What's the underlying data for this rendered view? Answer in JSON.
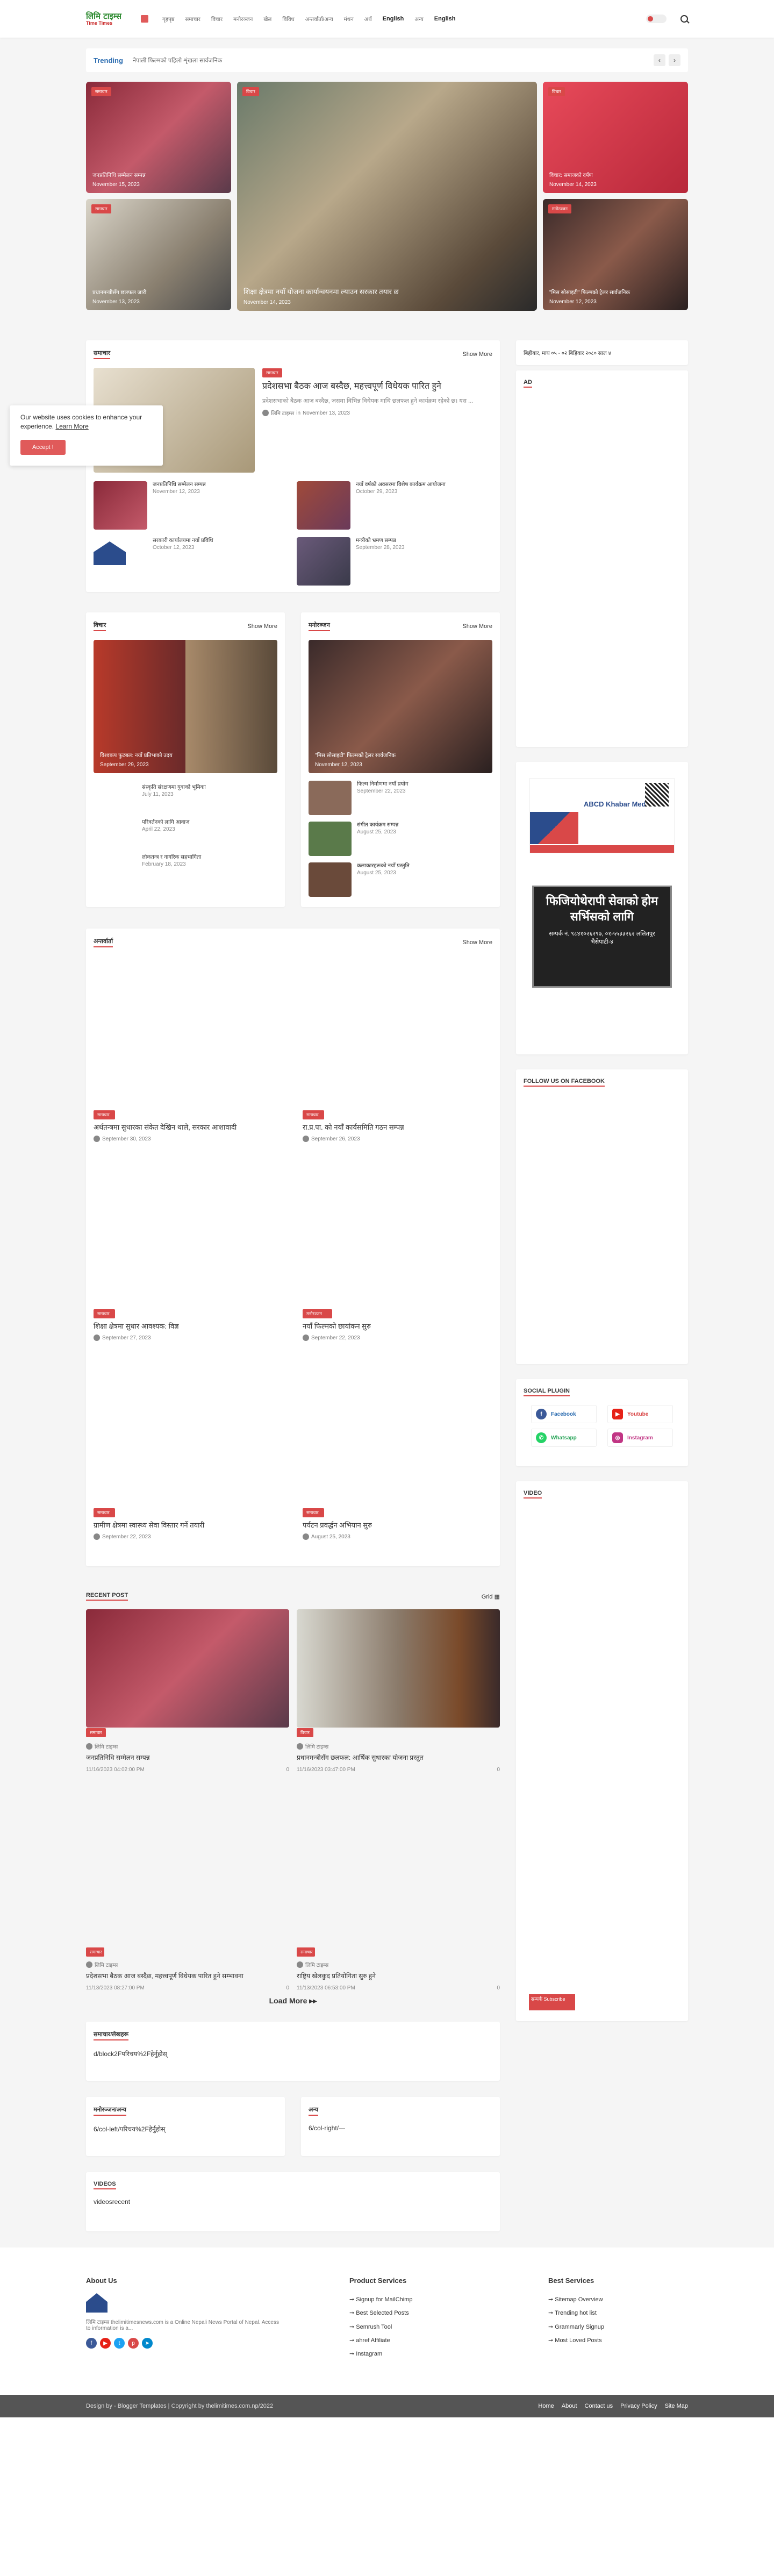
{
  "header": {
    "logo_text": "लिमि टाइम्स",
    "logo_sub": "Time Times",
    "nav": [
      "गृहपृष्ठ",
      "समाचार",
      "विचार",
      "मनोरञ्जन",
      "खेल",
      "विविध",
      "अन्तर्वार्ता/अन्य",
      "मंथन",
      "अर्थ",
      "English",
      "अन्य",
      "English"
    ]
  },
  "trending": {
    "label": "Trending",
    "text": "नेपाली फिल्मको पहिलो शृंखला सार्वजनिक"
  },
  "hero": [
    {
      "label": "समाचार",
      "title": "जनप्रतिनिधि सम्मेलन सम्पन्न",
      "date": "November 15, 2023",
      "comments": "0"
    },
    {
      "label": "समाचार",
      "title": "प्रधानमन्त्रीसँग छलफल जारी",
      "date": "November 13, 2023",
      "comments": "0"
    },
    {
      "label": "विचार",
      "title": "शिक्षा क्षेत्रमा नयाँ योजना कार्यान्वयनमा ल्याउन सरकार तयार छ",
      "date": "November 14, 2023",
      "comments": "0"
    },
    {
      "label": "विचार",
      "title": "विचार: समाजको दर्पण",
      "date": "November 14, 2023",
      "comments": "0"
    },
    {
      "label": "मनोरञ्जन",
      "title": "\"मिस सोसाइटी\" फिल्मको ट्रेलर सार्वजनिक",
      "date": "November 12, 2023",
      "comments": "0"
    }
  ],
  "sec1": {
    "title": "समाचार",
    "show_more": "Show More",
    "lead_title": "प्रदेशसभा बैठक आज बस्दैछ, महत्त्वपूर्ण विधेयक पारित हुने",
    "lead_excerpt": "प्रदेशसभाको बैठक आज बस्दैछ, जसमा विभिन्न विधेयक माथि छलफल हुने कार्यक्रम रहेको छ। यस ...",
    "lead_author": "लिमि टाइम्स",
    "lead_date": "November 13, 2023",
    "items": [
      {
        "title": "जनप्रतिनिधि सम्मेलन सम्पन्न",
        "date": "November 12, 2023"
      },
      {
        "title": "नयाँ वर्षको अवसरमा विशेष कार्यक्रम आयोजना",
        "date": "October 29, 2023"
      },
      {
        "title": "सरकारी कार्यालयमा नयाँ प्रविधि",
        "date": "October 12, 2023"
      },
      {
        "title": "मन्त्रीको भ्रमण सम्पन्न",
        "date": "September 28, 2023"
      }
    ]
  },
  "sec2": {
    "title": "विचार",
    "show_more": "Show More",
    "lead_title": "विश्वकप फुटबल: नयाँ प्रतिभाको उदय",
    "lead_date": "September 29, 2023",
    "items": [
      {
        "title": "संस्कृति संरक्षणमा युवाको भूमिका",
        "date": "July 11, 2023"
      },
      {
        "title": "परिवर्तनको लागि आवाज",
        "date": "April 22, 2023"
      },
      {
        "title": "लोकतन्त्र र नागरिक सहभागिता",
        "date": "February 18, 2023"
      }
    ]
  },
  "sec3": {
    "title": "मनोरञ्जन",
    "show_more": "Show More",
    "lead_title": "\"मिस सोसाइटी\" फिल्मको ट्रेलर सार्वजनिक",
    "lead_date": "November 12, 2023",
    "items": [
      {
        "title": "फिल्म निर्माणमा नयाँ प्रयोग",
        "date": "September 22, 2023"
      },
      {
        "title": "संगीत कार्यक्रम सम्पन्न",
        "date": "August 25, 2023"
      },
      {
        "title": "कलाकारहरूको नयाँ प्रस्तुति",
        "date": "August 25, 2023"
      }
    ]
  },
  "sec4": {
    "title": "अन्तर्वार्ता",
    "show_more": "Show More",
    "posts": [
      {
        "label": "समाचार",
        "title": "अर्थतन्त्रमा सुधारका संकेत देखिन थाले, सरकार आशावादी",
        "date": "September 30, 2023"
      },
      {
        "label": "समाचार",
        "title": "रा.प्र.पा. को नयाँ कार्यसमिति गठन सम्पन्न",
        "date": "September 26, 2023"
      },
      {
        "label": "समाचार",
        "title": "शिक्षा क्षेत्रमा सुधार आवश्यक: विज्ञ",
        "date": "September 27, 2023"
      },
      {
        "label": "मनोरञ्जन",
        "title": "नयाँ फिल्मको छायांकन सुरु",
        "date": "September 22, 2023"
      },
      {
        "label": "समाचार",
        "title": "ग्रामीण क्षेत्रमा स्वास्थ्य सेवा विस्तार गर्ने तयारी",
        "date": "September 22, 2023"
      },
      {
        "label": "समाचार",
        "title": "पर्यटन प्रवर्द्धन अभियान सुरु",
        "date": "August 25, 2023"
      }
    ]
  },
  "recent": {
    "title": "RECENT POST",
    "grid": "Grid",
    "posts": [
      {
        "label": "समाचार",
        "author": "लिमि टाइम्स",
        "title": "जनप्रतिनिधि सम्मेलन सम्पन्न",
        "date": "11/16/2023 04:02:00 PM",
        "comments": "0"
      },
      {
        "label": "विचार",
        "author": "लिमि टाइम्स",
        "title": "प्रधानमन्त्रीसँग छलफल: आर्थिक सुधारका योजना प्रस्तुत",
        "date": "11/16/2023 03:47:00 PM",
        "comments": "0"
      },
      {
        "label": "समाचार",
        "author": "लिमि टाइम्स",
        "title": "प्रदेशसभा बैठक आज बस्दैछ, महत्त्वपूर्ण विधेयक पारित हुने सम्भावना",
        "date": "11/13/2023 08:27:00 PM",
        "comments": "0"
      },
      {
        "label": "समाचार",
        "author": "लिमि टाइम्स",
        "title": "राष्ट्रिय खेलकुद प्रतियोगिता सुरु हुने",
        "date": "11/13/2023 06:53:00 PM",
        "comments": "0"
      }
    ],
    "load_more": "Load More"
  },
  "widgets": {
    "w1": "समाचार/लेखहरू",
    "w1_text": "d/block2Fपरिचय%2Fहेर्नुहोस्",
    "w2": "मनोरञ्जन/अन्य",
    "w2_text": "6/col-left/परिचय%2Fहेर्नुहोस्",
    "w3": "अन्य",
    "w3_text": "6/col-right/—",
    "videos": "VIDEOS",
    "videos_text": "videosrecent"
  },
  "sidebar": {
    "date": "बिहीबार, माघ ०५ - ०२ बिहिवार  २०८० साल ४",
    "ad": "AD",
    "ad_text": "ABCD Khabar Media",
    "hoarding": "फिजियोथेरापी सेवाको होम सर्भिसको लागि",
    "hoarding_sub": "सम्पर्क नं. ९८४१०२६२९७, ०१-५५३३२६२ ललितपुर भैसेपाटी-४",
    "facebook": "FOLLOW US ON FACEBOOK",
    "social": "SOCIAL PLUGIN",
    "social_items": [
      "Facebook",
      "Youtube",
      "Whatsapp",
      "Instagram"
    ],
    "video": "VIDEO",
    "badge": "सम्पर्क Subscribe"
  },
  "cookie": {
    "text": "Our website uses cookies to enhance your experience.",
    "link": "Learn More",
    "button": "Accept !"
  },
  "footer": {
    "about": "About Us",
    "about_text": "लिमि टाइम्स thelimitimesnews.com is a Online Nepali News Portal of Nepal. Access to information is a...",
    "ps": "Product Services",
    "ps_items": [
      "Signup for MailChimp",
      "Best Selected Posts",
      "Semrush Tool",
      "ahref Affiliate",
      "Instagram"
    ],
    "bs": "Best Services",
    "bs_items": [
      "Sitemap Overview",
      "Trending hot list",
      "Grammarly Signup",
      "Most Loved Posts"
    ],
    "copy": "Design by - Blogger Templates | Copyright by thelimitimes.com.np/2022",
    "links": [
      "Home",
      "About",
      "Contact us",
      "Privacy Policy",
      "Site Map"
    ]
  },
  "colors": {
    "accent": "#d94848",
    "link": "#2b6cb0"
  }
}
